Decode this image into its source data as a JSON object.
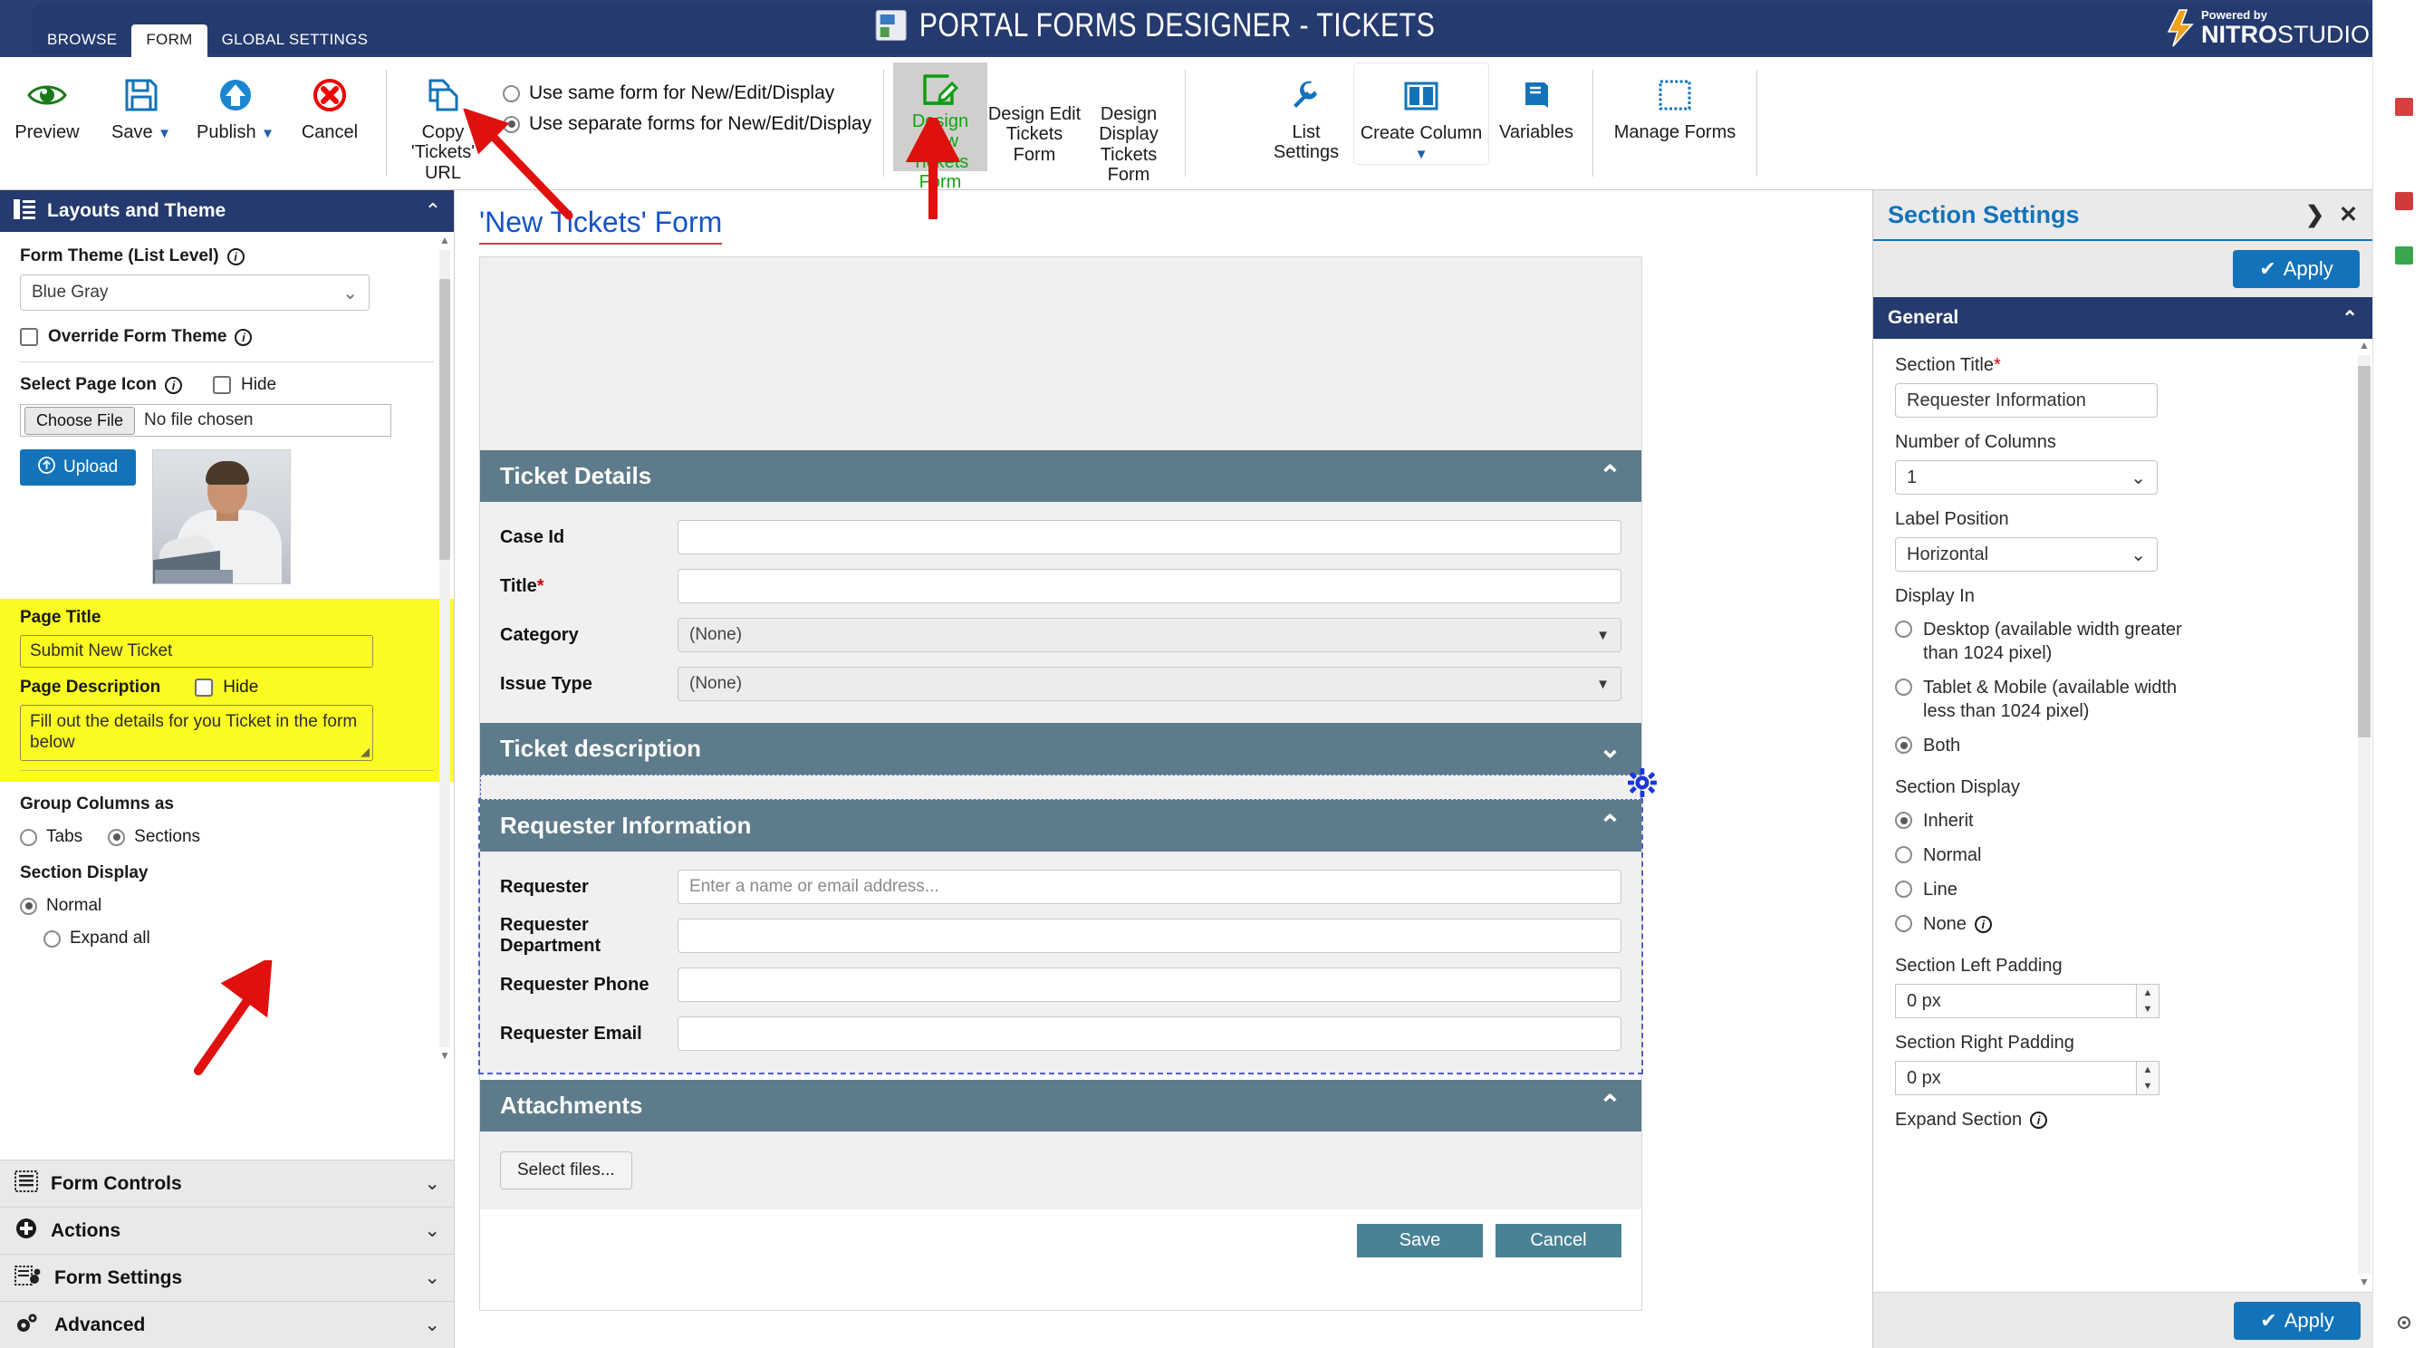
{
  "titlebar": {
    "app_title": "PORTAL FORMS DESIGNER - TICKETS",
    "brand_powered": "Powered by",
    "brand_name_bold": "NITRO",
    "brand_name_light": "STUDIO",
    "app_icon": "forms-designer-icon"
  },
  "ribbon_tabs": [
    {
      "label": "BROWSE",
      "active": false
    },
    {
      "label": "FORM",
      "active": true
    },
    {
      "label": "GLOBAL SETTINGS",
      "active": false
    }
  ],
  "ribbon": {
    "preview": "Preview",
    "save": "Save",
    "publish": "Publish",
    "cancel": "Cancel",
    "copy_url_line1": "Copy",
    "copy_url_line2": "'Tickets' URL",
    "radio_same": "Use same form for New/Edit/Display",
    "radio_separate": "Use separate forms for New/Edit/Display",
    "radio_selected": "separate",
    "design_new": "Design New\nTickets Form",
    "design_edit": "Design Edit\nTickets Form",
    "design_display": "Design Display\nTickets Form",
    "list_settings": "List Settings",
    "create_column": "Create Column",
    "variables": "Variables",
    "manage_forms": "Manage Forms"
  },
  "left_panel": {
    "header_title": "Layouts and Theme",
    "header_icon": "layout-icon",
    "form_theme_label": "Form Theme (List Level)",
    "form_theme_value": "Blue Gray",
    "override_form_theme": "Override Form Theme",
    "override_checked": false,
    "select_page_icon_label": "Select Page Icon",
    "hide_label": "Hide",
    "hide_icon_checked": false,
    "choose_file_button": "Choose File",
    "no_file_chosen": "No file chosen",
    "upload_button": "Upload",
    "page_title_label": "Page Title",
    "page_title_value": "Submit New Ticket",
    "page_description_label": "Page Description",
    "page_description_hide": "Hide",
    "page_description_hide_checked": false,
    "page_description_value": "Fill out the details for you Ticket in the form below",
    "group_columns_label": "Group Columns as",
    "group_tabs": "Tabs",
    "group_sections": "Sections",
    "group_selected": "Sections",
    "section_display_label": "Section Display",
    "section_display_normal": "Normal",
    "section_display_expand_all": "Expand all",
    "section_display_selected": "Normal",
    "accordion": [
      {
        "label": "Form Controls",
        "icon": "form-controls-icon"
      },
      {
        "label": "Actions",
        "icon": "plus-circle-icon"
      },
      {
        "label": "Form Settings",
        "icon": "form-settings-icon"
      },
      {
        "label": "Advanced",
        "icon": "gears-icon"
      }
    ]
  },
  "center": {
    "form_heading": "'New Tickets' Form",
    "sections": [
      {
        "title": "Ticket Details",
        "collapsed": false,
        "fields": [
          {
            "label": "Case Id",
            "required": false,
            "type": "text",
            "value": ""
          },
          {
            "label": "Title",
            "required": true,
            "type": "text",
            "value": ""
          },
          {
            "label": "Category",
            "required": false,
            "type": "select",
            "value": "(None)"
          },
          {
            "label": "Issue Type",
            "required": false,
            "type": "select",
            "value": "(None)"
          }
        ]
      },
      {
        "title": "Ticket description",
        "collapsed": true,
        "fields": []
      },
      {
        "title": "Requester Information",
        "collapsed": false,
        "selected": true,
        "fields": [
          {
            "label": "Requester",
            "required": false,
            "type": "text",
            "value": "",
            "placeholder": "Enter a name or email address..."
          },
          {
            "label": "Requester Department",
            "required": false,
            "type": "text",
            "value": ""
          },
          {
            "label": "Requester Phone",
            "required": false,
            "type": "text",
            "value": ""
          },
          {
            "label": "Requester Email",
            "required": false,
            "type": "text",
            "value": ""
          }
        ]
      },
      {
        "title": "Attachments",
        "collapsed": false,
        "fields": []
      }
    ],
    "select_files_button": "Select files...",
    "save_button": "Save",
    "cancel_button": "Cancel",
    "gear_icon": "section-settings-gear-icon"
  },
  "right_panel": {
    "title": "Section Settings",
    "expand_icon": "chevron-right-icon",
    "close_icon": "close-icon",
    "apply_button": "Apply",
    "group_title": "General",
    "section_title_label": "Section Title",
    "section_title_value": "Requester Information",
    "number_of_columns_label": "Number of Columns",
    "number_of_columns_value": "1",
    "label_position_label": "Label Position",
    "label_position_value": "Horizontal",
    "display_in_label": "Display In",
    "display_in_options": [
      "Desktop (available width greater than 1024 pixel)",
      "Tablet & Mobile (available width less than 1024 pixel)",
      "Both"
    ],
    "display_in_selected": "Both",
    "section_display_label": "Section Display",
    "section_display_options": [
      "Inherit",
      "Normal",
      "Line",
      "None"
    ],
    "section_display_selected": "Inherit",
    "section_left_padding_label": "Section Left Padding",
    "section_left_padding_value": "0 px",
    "section_right_padding_label": "Section Right Padding",
    "section_right_padding_value": "0 px",
    "expand_section_label": "Expand Section",
    "footer_apply_button": "Apply"
  },
  "colors": {
    "navy": "#253a6e",
    "ribbon_blue": "#1273ba",
    "section_header": "#5d7b8a",
    "highlight_yellow": "#fbfb21",
    "annotation_red": "#e0100f",
    "heading_blue": "#1653c8",
    "green_accent": "#11a311"
  }
}
